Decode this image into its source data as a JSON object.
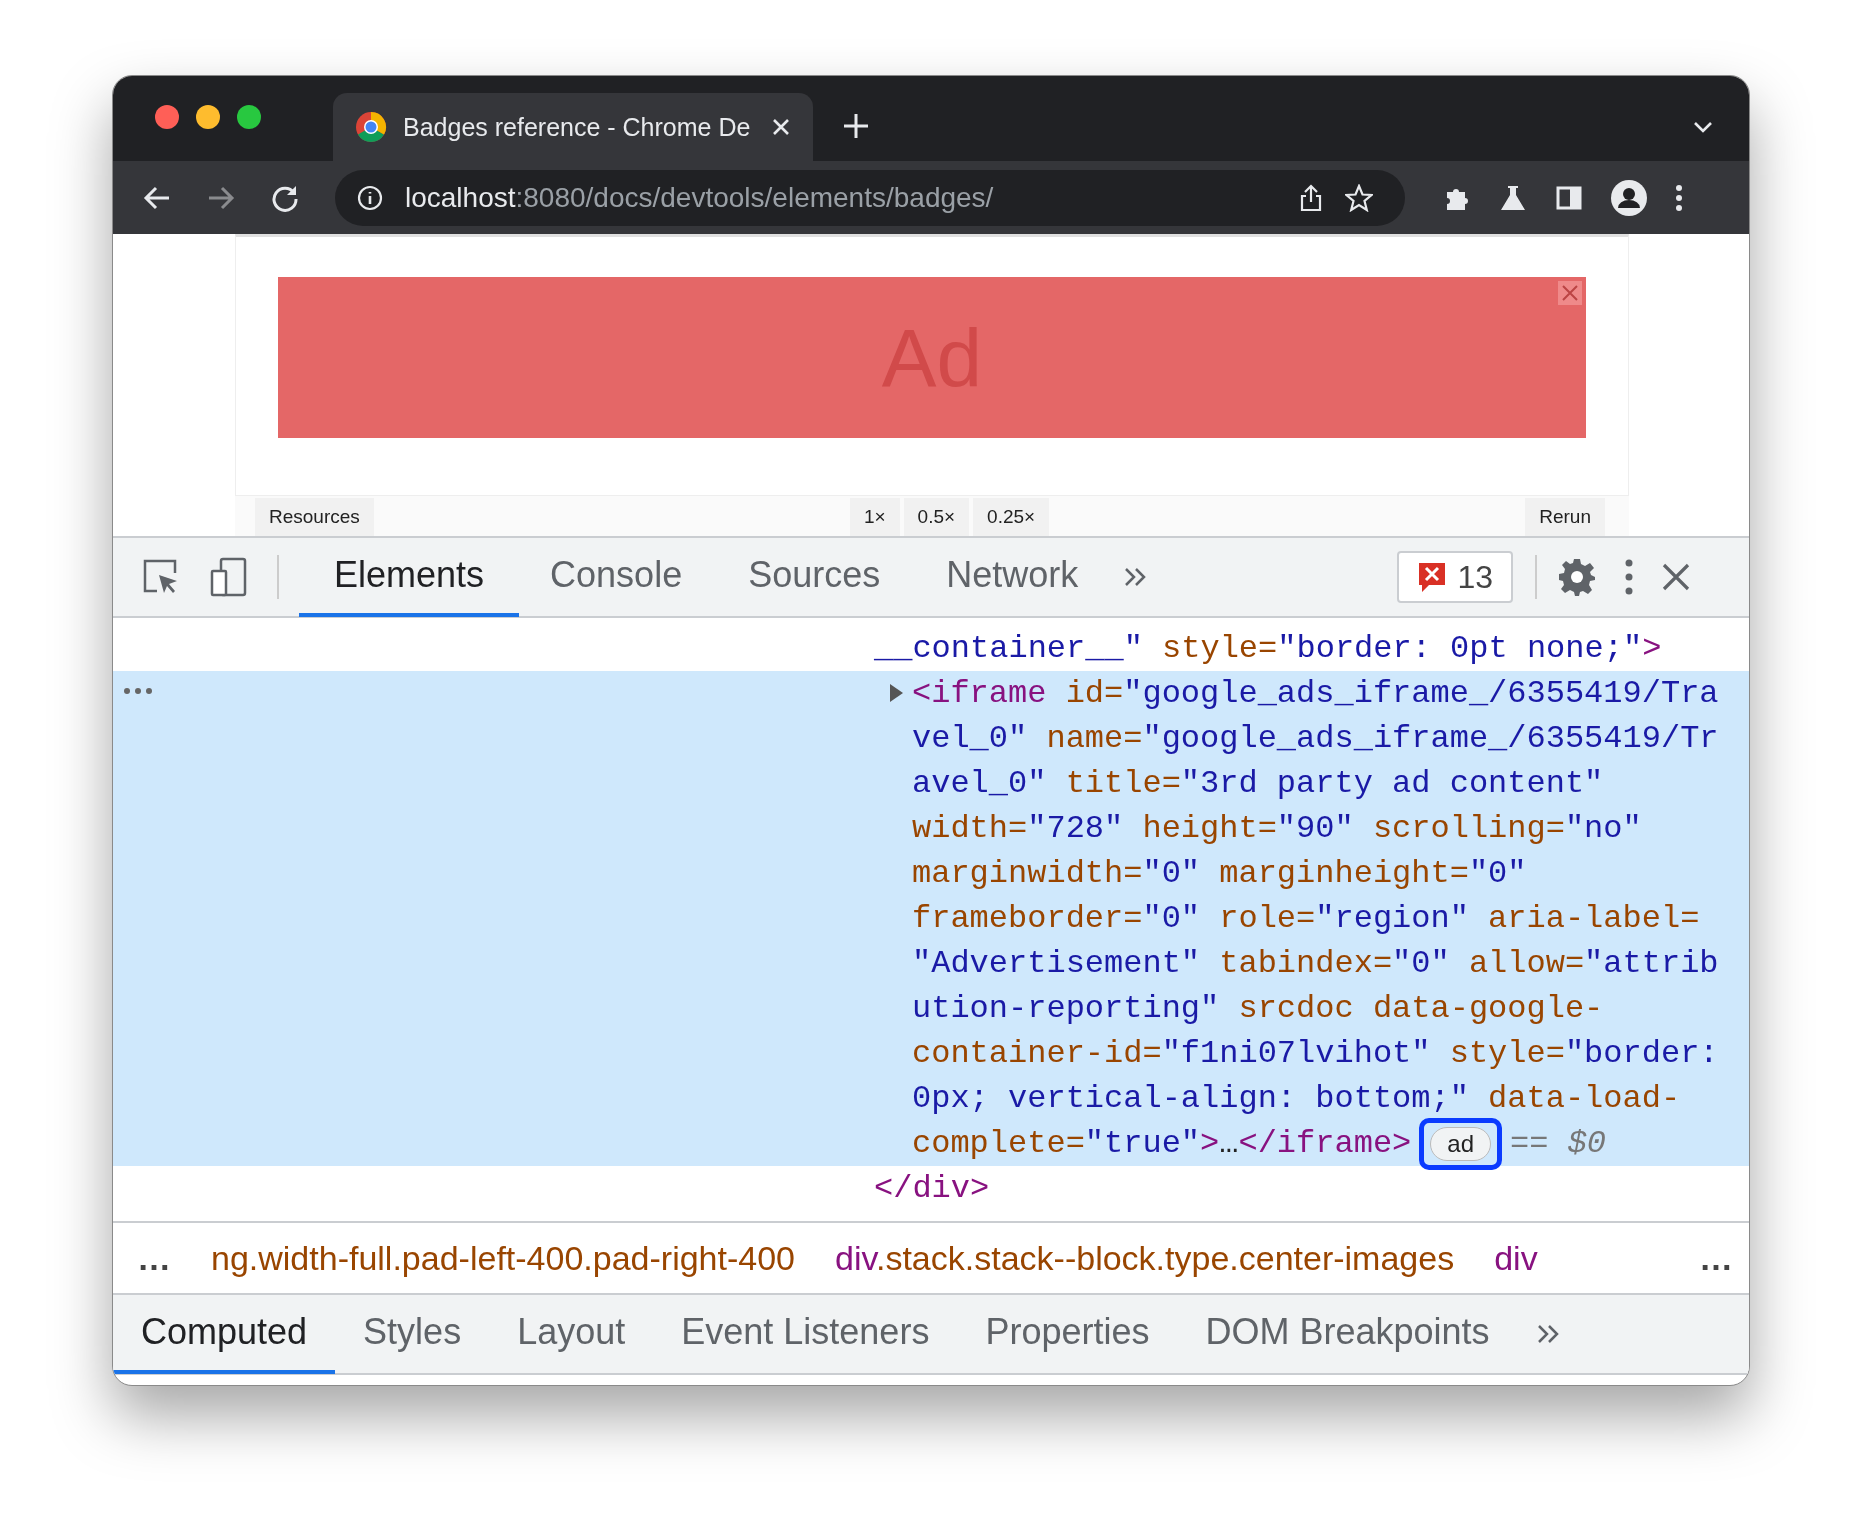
{
  "browser": {
    "tab": {
      "title": "Badges reference - Chrome De"
    },
    "address": {
      "host": "localhost",
      "path": ":8080/docs/devtools/elements/badges/"
    }
  },
  "page": {
    "ad": {
      "label": "Ad"
    },
    "tools": [
      {
        "kind": "left",
        "label": "Resources"
      },
      {
        "kind": "zoom",
        "label": "1×"
      },
      {
        "kind": "zoom",
        "label": "0.5×"
      },
      {
        "kind": "zoom",
        "label": "0.25×"
      },
      {
        "kind": "right",
        "label": "Rerun"
      }
    ]
  },
  "devtools": {
    "tabs": [
      {
        "label": "Elements",
        "selected": true
      },
      {
        "label": "Console",
        "selected": false
      },
      {
        "label": "Sources",
        "selected": false
      },
      {
        "label": "Network",
        "selected": false
      }
    ],
    "error_count": "13",
    "code_rows": [
      {
        "kind": "text",
        "selected": false,
        "lines": [
          [
            {
              "kind": "value",
              "text": "__container__\""
            },
            {
              "kind": "attr",
              "text": " style="
            },
            {
              "kind": "value",
              "text": "\"border: 0pt none;\""
            },
            {
              "kind": "tag",
              "text": ">"
            }
          ]
        ]
      },
      {
        "kind": "element",
        "selected": true,
        "expanded": false,
        "annotated": true,
        "badge": "ad",
        "marker": "== $0",
        "lines": [
          [
            {
              "kind": "tag",
              "text": "<iframe"
            },
            {
              "kind": "attr",
              "text": " id="
            },
            {
              "kind": "value",
              "text": "\"google_ads_iframe_/6355419/Tra"
            }
          ],
          [
            {
              "kind": "value",
              "text": "vel_0\""
            },
            {
              "kind": "attr",
              "text": " name="
            },
            {
              "kind": "value",
              "text": "\"google_ads_iframe_/6355419/Tr"
            }
          ],
          [
            {
              "kind": "value",
              "text": "avel_0\""
            },
            {
              "kind": "attr",
              "text": " title="
            },
            {
              "kind": "value",
              "text": "\"3rd party ad content\""
            }
          ],
          [
            {
              "kind": "attr",
              "text": "width="
            },
            {
              "kind": "value",
              "text": "\"728\""
            },
            {
              "kind": "attr",
              "text": " height="
            },
            {
              "kind": "value",
              "text": "\"90\""
            },
            {
              "kind": "attr",
              "text": " scrolling="
            },
            {
              "kind": "value",
              "text": "\"no\""
            }
          ],
          [
            {
              "kind": "attr",
              "text": "marginwidth="
            },
            {
              "kind": "value",
              "text": "\"0\""
            },
            {
              "kind": "attr",
              "text": " marginheight="
            },
            {
              "kind": "value",
              "text": "\"0\""
            }
          ],
          [
            {
              "kind": "attr",
              "text": "frameborder="
            },
            {
              "kind": "value",
              "text": "\"0\""
            },
            {
              "kind": "attr",
              "text": " role="
            },
            {
              "kind": "value",
              "text": "\"region\""
            },
            {
              "kind": "attr",
              "text": " aria-label="
            }
          ],
          [
            {
              "kind": "value",
              "text": "\"Advertisement\""
            },
            {
              "kind": "attr",
              "text": " tabindex="
            },
            {
              "kind": "value",
              "text": "\"0\""
            },
            {
              "kind": "attr",
              "text": " allow="
            },
            {
              "kind": "value",
              "text": "\"attrib"
            }
          ],
          [
            {
              "kind": "value",
              "text": "ution-reporting\""
            },
            {
              "kind": "attr",
              "text": " srcdoc data-google-"
            }
          ],
          [
            {
              "kind": "attr",
              "text": "container-id="
            },
            {
              "kind": "value",
              "text": "\"f1ni07lvihot\""
            },
            {
              "kind": "attr",
              "text": " style="
            },
            {
              "kind": "value",
              "text": "\"border:"
            }
          ],
          [
            {
              "kind": "value",
              "text": "0px; vertical-align: bottom;\""
            },
            {
              "kind": "attr",
              "text": " data-load-"
            }
          ],
          [
            {
              "kind": "attr",
              "text": "complete="
            },
            {
              "kind": "value",
              "text": "\"true\""
            },
            {
              "kind": "tag",
              "text": ">"
            },
            {
              "kind": "plain",
              "text": "…"
            },
            {
              "kind": "tag",
              "text": "</iframe>"
            }
          ]
        ]
      },
      {
        "kind": "close",
        "selected": false,
        "lines": [
          [
            {
              "kind": "tag",
              "text": "</div>"
            }
          ]
        ]
      }
    ],
    "breadcrumbs": {
      "scroll_left": "…",
      "items": [
        {
          "classes": "ng.width-full.pad-left-400.pad-right-400"
        },
        {
          "tag": "div",
          "classes": ".stack.stack--block.type.center-images"
        },
        {
          "tag": "div"
        }
      ],
      "scroll_right": "…"
    },
    "panel_tabs": [
      {
        "label": "Computed",
        "selected": true
      },
      {
        "label": "Styles",
        "selected": false
      },
      {
        "label": "Layout",
        "selected": false
      },
      {
        "label": "Event Listeners",
        "selected": false
      },
      {
        "label": "Properties",
        "selected": false
      },
      {
        "label": "DOM Breakpoints",
        "selected": false
      }
    ]
  }
}
